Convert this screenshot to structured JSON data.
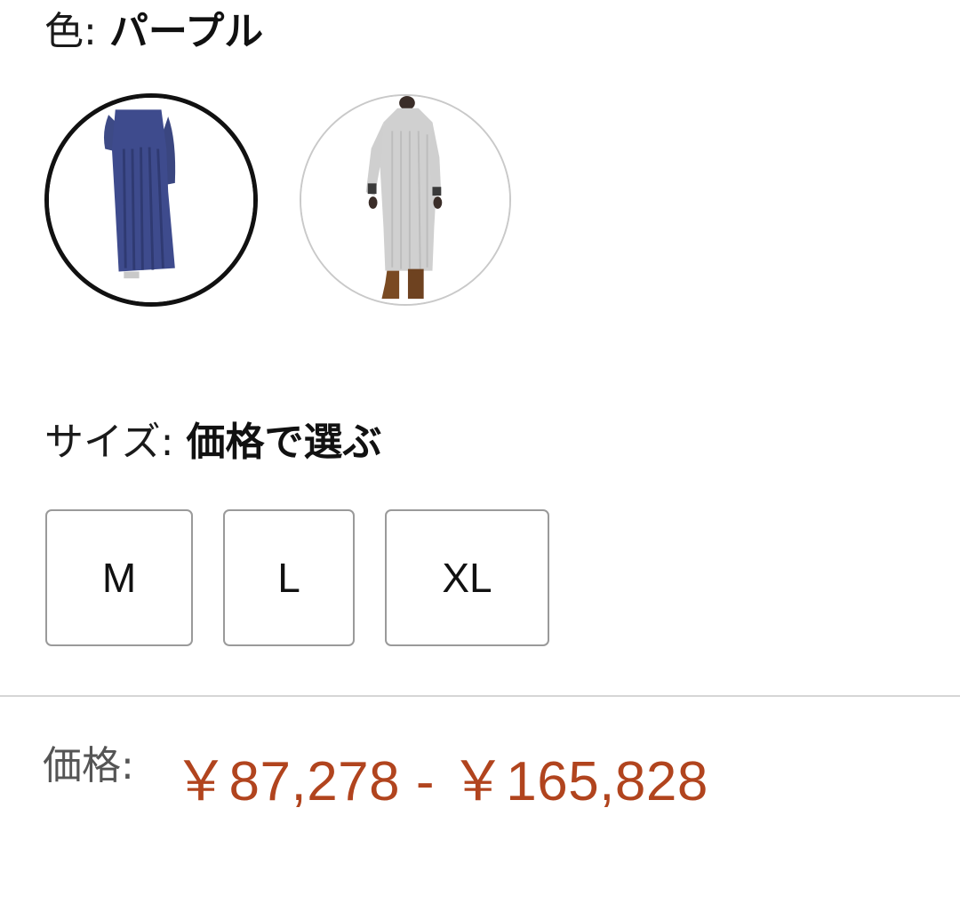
{
  "color": {
    "label": "色:",
    "selected_value": "パープル",
    "swatches": [
      {
        "name": "purple",
        "selected": true
      },
      {
        "name": "gray",
        "selected": false
      }
    ]
  },
  "size": {
    "label": "サイズ:",
    "selected_value": "価格で選ぶ",
    "options": [
      "M",
      "L",
      "XL"
    ]
  },
  "price": {
    "label": "価格:",
    "value": "￥87,278 - ￥165,828"
  },
  "colors": {
    "price": "#b1441e",
    "selected_border": "#111111",
    "unselected_border": "#c9c9c9",
    "button_border": "#9a9a9a",
    "divider": "#d6d6d6"
  }
}
